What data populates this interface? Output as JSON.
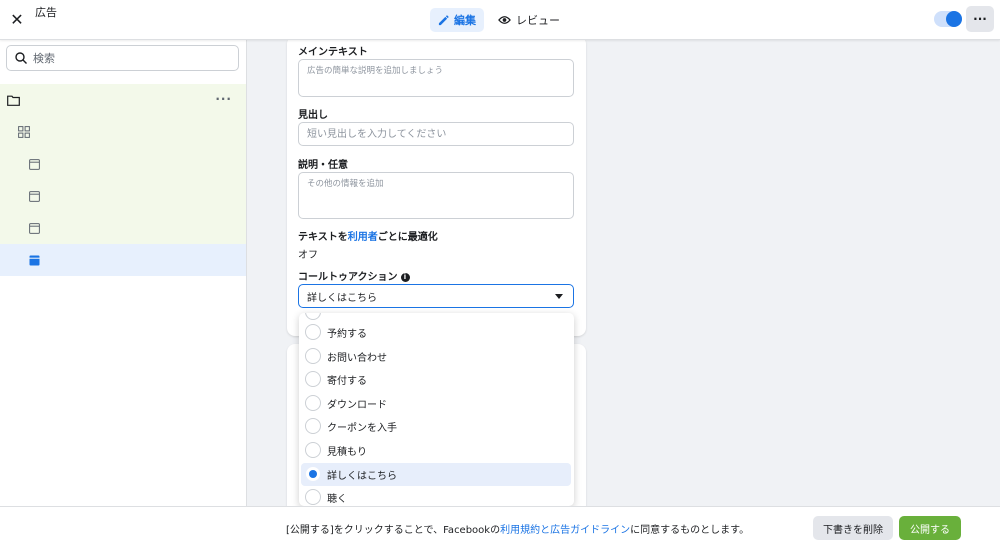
{
  "header": {
    "close_icon": "close-icon",
    "title": "広告",
    "tabs": [
      {
        "label": "編集",
        "icon": "pencil-icon",
        "active": true
      },
      {
        "label": "レビュー",
        "icon": "eye-icon",
        "active": false
      }
    ],
    "toggle_on": true,
    "more_label": "···"
  },
  "sidebar": {
    "search_placeholder": "検索",
    "tree": [
      {
        "icon": "folder-icon",
        "level": 0,
        "menu": "···"
      },
      {
        "icon": "grid-icon",
        "level": 1
      },
      {
        "icon": "ad-icon",
        "level": 2
      },
      {
        "icon": "ad-icon",
        "level": 2
      },
      {
        "icon": "ad-icon",
        "level": 2
      },
      {
        "icon": "ad-icon",
        "level": 2,
        "selected": true
      }
    ]
  },
  "form": {
    "main_text_label": "メインテキスト",
    "main_text_placeholder": "広告の簡単な説明を追加しましょう",
    "headline_label": "見出し",
    "headline_placeholder": "短い見出しを入力してください",
    "description_label": "説明・任意",
    "description_placeholder": "その他の情報を追加",
    "optimize_prefix": "テキストを",
    "optimize_link": "利用者",
    "optimize_suffix": "ごとに最適化",
    "optimize_value": "オフ",
    "cta_label": "コールトゥアクション",
    "cta_selected": "詳しくはこちら",
    "cta_options": [
      {
        "label": "予約する"
      },
      {
        "label": "お問い合わせ"
      },
      {
        "label": "寄付する"
      },
      {
        "label": "ダウンロード"
      },
      {
        "label": "クーポンを入手"
      },
      {
        "label": "見積もり"
      },
      {
        "label": "詳しくはこちら",
        "selected": true
      },
      {
        "label": "聴く"
      }
    ]
  },
  "footer": {
    "text_prefix": "[公開する]をクリックすることで、Facebookの",
    "text_link1": "利用規約",
    "text_mid": "と",
    "text_link2": "広告ガイドライン",
    "text_suffix": "に同意するものとします。",
    "discard_label": "下書きを削除",
    "publish_label": "公開する"
  },
  "colors": {
    "accent": "#1b74e4",
    "publish": "#69b03b",
    "tree_highlight": "#f3f9ea"
  }
}
